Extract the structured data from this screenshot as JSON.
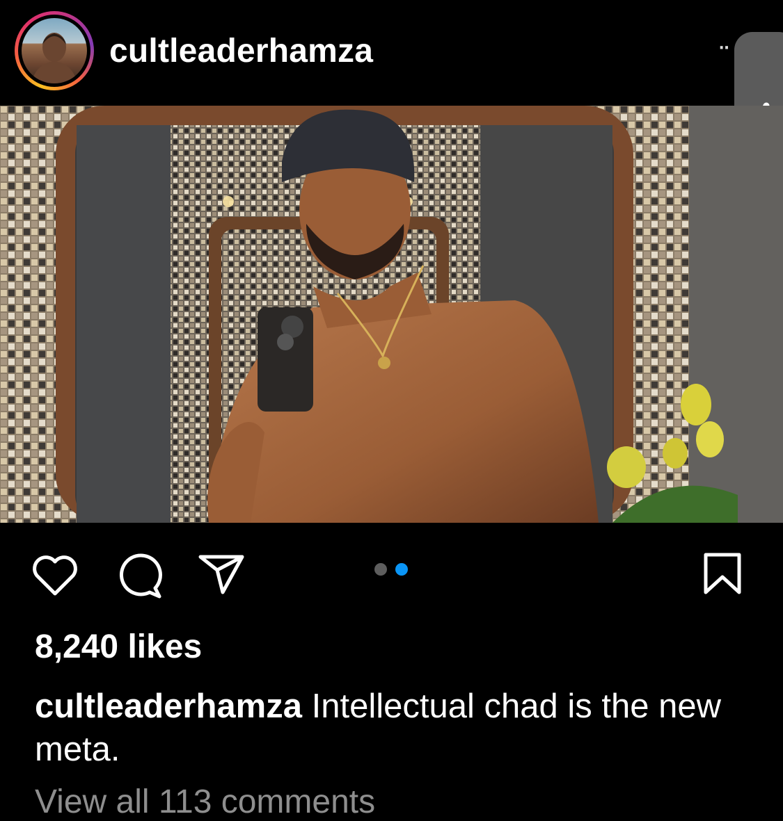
{
  "post": {
    "username": "cultleaderhamza",
    "more_label": "··"
  },
  "media": {
    "carousel_count": 2,
    "carousel_active_index": 2
  },
  "stats": {
    "likes": "8,240 likes"
  },
  "caption": {
    "username": "cultleaderhamza",
    "text": "Intellectual chad is the new meta."
  },
  "comments": {
    "view_all": "View all 113 comments"
  },
  "icons": {
    "like": "heart-icon",
    "comment": "comment-bubble-icon",
    "share": "paper-plane-icon",
    "save": "bookmark-icon",
    "side_handle": "chevron-left-icon"
  },
  "colors": {
    "background": "#000000",
    "text": "#ffffff",
    "active_dot": "#0a95f6",
    "inactive_dot": "#5e5e5e",
    "muted_text": "#8e8e8e"
  }
}
